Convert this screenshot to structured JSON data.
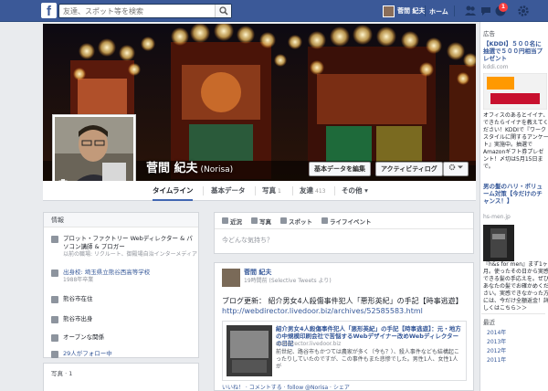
{
  "topbar": {
    "search_placeholder": "友達、スポット等を検索",
    "user_name": "菅間 紀夫",
    "home_label": "ホーム",
    "notification_count": "1"
  },
  "profile": {
    "name": "菅間 紀夫",
    "alt_name": "(Norisa)",
    "update_info_label": "基本データを編集",
    "activity_log_label": "アクティビティログ"
  },
  "tabs": [
    {
      "label": "タイムライン",
      "count": ""
    },
    {
      "label": "基本データ",
      "count": ""
    },
    {
      "label": "写真",
      "count": "1"
    },
    {
      "label": "友達",
      "count": "413"
    },
    {
      "label": "その他",
      "count": ""
    }
  ],
  "info": {
    "title": "情報",
    "rows": [
      {
        "main": "プロット・ファクトリー Webディレクター & パソコン講師 & プロガー",
        "sub": "以前の職場: リクルート、御殿場自治インターメディア"
      },
      {
        "main": "出身校: 埼玉県立熊谷西高等学校",
        "sub": "1988年卒業"
      },
      {
        "main": "熊谷市在住",
        "sub": ""
      },
      {
        "main": "熊谷市出身",
        "sub": ""
      },
      {
        "main": "オープンな関係",
        "sub": ""
      },
      {
        "main": "29人がフォロー中",
        "sub": ""
      }
    ],
    "photos_label": "写真 · 1"
  },
  "composer": {
    "tabs": [
      "近況",
      "写真",
      "スポット",
      "ライフイベント"
    ],
    "placeholder": "今どんな気持ち？"
  },
  "post": {
    "author": "菅間 紀夫",
    "meta": "19時間前 (Selective Tweets より)",
    "text": "ブログ更新： 紹介男女4人殺傷事件犯人「悪形英紀」の手記【時事逃遊】",
    "link_url": "http://webdirector.livedoor.biz/archives/52585583.html",
    "link_title": "紹介男女4人殺傷事件犯人「悪形英紀」の手記【時事逃遊】：元・地方の中規模印刷会社で苦悩するWebデザイナー改めWebディレクターの日記",
    "link_src": "webdirector.livedoor.biz",
    "link_desc": "前世紀、路谷市もかつては農家が多く（今も？）、殺人事件なども結構起こったりしていたのですが、この事件もまた悲惨でした。男性1人、女性1人が",
    "actions": "いいね！ · コメントする · follow @Norisa · シェア"
  },
  "ads": {
    "header": "広告",
    "ad1": {
      "title": "【KDDI】５００名に抽選で５００円相当プレゼント",
      "url": "kddi.com",
      "body": "オフィスのあるとイイナ、できたらイイナを教えてください！KDDIで『ワークスタイルに関するアンケート』実施中。抽選でAmazonギフト券プレゼント！〆切は5月15日まで。"
    },
    "ad2": {
      "title": "男の髪のハリ・ボリューム対策【今だけのチャンス！】",
      "url": "hs-men.jp",
      "body": "『h&s for men』まず1ヶ月。使ったその日から実感できる髪の手応えを。ぜひあなたの髪でお確かめください。実感できなかった方には、今だけ全額返金！詳しくはこちら＞＞"
    }
  },
  "years": {
    "header": "最近",
    "items": [
      "2014年",
      "2013年",
      "2012年",
      "2011年"
    ]
  },
  "colors": {
    "brand": "#3b5998",
    "link": "#365899",
    "badge": "#fa3e3e"
  }
}
